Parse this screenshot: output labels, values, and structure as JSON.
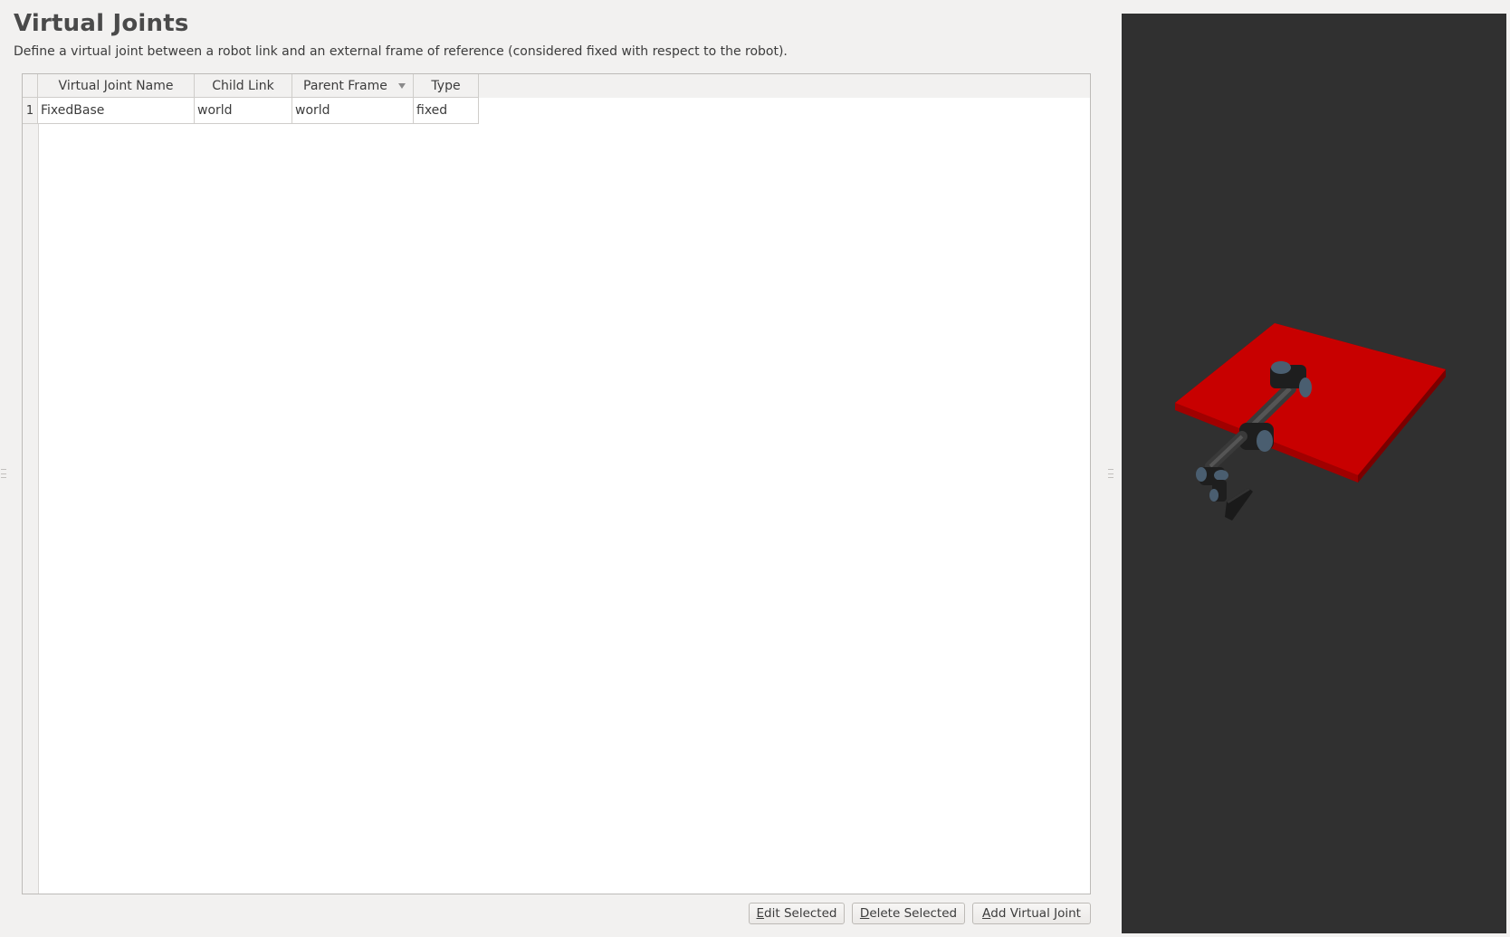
{
  "page": {
    "title": "Virtual Joints",
    "description": "Define a virtual joint between a robot link and an external frame of reference (considered fixed with respect to the robot)."
  },
  "table": {
    "columns": [
      "Virtual Joint Name",
      "Child Link",
      "Parent Frame",
      "Type"
    ],
    "sorted_column": "Parent Frame",
    "sort_indicator_icon": "sort-descending-icon",
    "rows": [
      {
        "index": "1",
        "cells": [
          "FixedBase",
          "world",
          "world",
          "fixed"
        ]
      }
    ]
  },
  "buttons": {
    "edit": {
      "mnemonic": "E",
      "rest": "dit Selected"
    },
    "delete": {
      "mnemonic": "D",
      "rest": "elete Selected"
    },
    "add": {
      "mnemonic": "A",
      "rest": "dd Virtual Joint"
    }
  },
  "viewport": {
    "description": "3D robot preview",
    "background": "#303030",
    "plate_color": "#cc0000",
    "robot_joint_color": "#4a5e70"
  }
}
